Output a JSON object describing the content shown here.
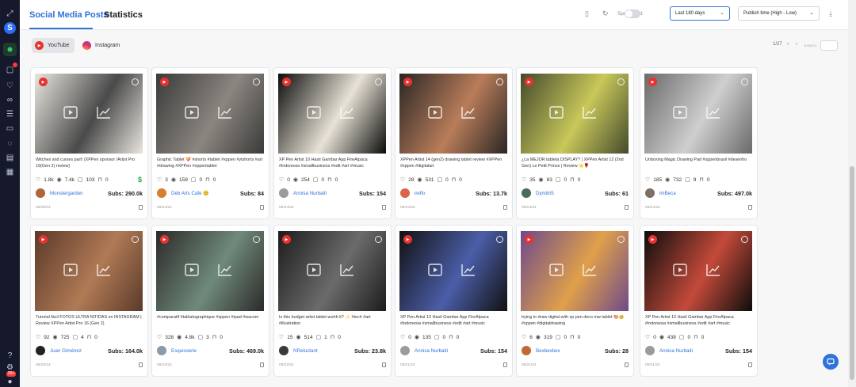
{
  "sidebar": {
    "logo": "S",
    "notification_badge": "99+",
    "icons": [
      "expand-icon",
      "logo-icon",
      "collaborators-icon",
      "notes-icon",
      "heart-icon",
      "link-icon",
      "list-icon",
      "folder-icon",
      "lightbulb-icon",
      "archive-icon",
      "calendar-icon",
      "help-icon",
      "settings-icon",
      "user-icon"
    ]
  },
  "header": {
    "tab_posts": "Social Media Posts",
    "tab_stats": "Statistics",
    "sponsored_label": "Sponsored",
    "sponsored_on": false,
    "date_range": "Last 180 days",
    "sort": "Publish time (High - Low)"
  },
  "platforms": [
    {
      "label": "YouTube",
      "active": true
    },
    {
      "label": "Instagram",
      "active": false
    }
  ],
  "pagination": {
    "page": "1/27",
    "goto_label": "Jump to"
  },
  "colors": {
    "accent": "#2f73da",
    "youtube": "#e8322e",
    "sponsor": "#22a653"
  },
  "cards": [
    {
      "caption": "Witches and curses part! (XPPen sponsor /Artist Pro 19(Gen 2) review)",
      "likes": "1.8k",
      "views": "7.4k",
      "comments": "103",
      "dislikes": "0",
      "sponsored": true,
      "author": "Monstergarden",
      "subs": "Subs: 290.0k",
      "date": "09/05/24",
      "thumb": [
        "#e9e6df",
        "#4a4a4a"
      ],
      "avatar": "#b0663c"
    },
    {
      "caption": "Graphic Tablet 💝 #shorts #tablet #xppen #ytshorts #art #drawing #XPPen #xppentablet",
      "likes": "3",
      "views": "159",
      "comments": "0",
      "dislikes": "0",
      "sponsored": false,
      "author": "Deb Arts Cafe 😊",
      "subs": "Subs: 84",
      "date": "09/24/24",
      "thumb": [
        "#3b3a39",
        "#8a8680"
      ],
      "avatar": "#d6802d"
    },
    {
      "caption": "XP Pen Artist 10 Hasil Gambar App FireAlpaca #indonesia #smallbusiness #edit #art #music",
      "likes": "0",
      "views": "254",
      "comments": "0",
      "dislikes": "0",
      "sponsored": false,
      "author": "Annisa Nurbaiti",
      "subs": "Subs: 154",
      "date": "09/24/24",
      "thumb": [
        "#0c0c0c",
        "#e8e3d6"
      ],
      "avatar": "#9b9b9b"
    },
    {
      "caption": "XPPen Artist 14 (gen2) drawing tablet review #XPPen #xppen #digitalart",
      "likes": "28",
      "views": "531",
      "comments": "0",
      "dislikes": "0",
      "sponsored": false,
      "author": "ireflo",
      "subs": "Subs: 13.7k",
      "date": "09/24/24",
      "thumb": [
        "#2a2624",
        "#b97d5a"
      ],
      "avatar": "#d9664a"
    },
    {
      "caption": "¿La MEJOR tableta DISPLAY? | XPPen Artist 12 (2nd Gen) Le Petit Prince | Review 🌟🌹",
      "likes": "35",
      "views": "83",
      "comments": "0",
      "dislikes": "0",
      "sponsored": false,
      "author": "Dymitri5",
      "subs": "Subs: 61",
      "date": "09/24/24",
      "thumb": [
        "#444a2c",
        "#c8c85a"
      ],
      "avatar": "#4d6b5a"
    },
    {
      "caption": "Unboxing Magic Drawing Pad #xppenbrasil #desenho",
      "likes": "185",
      "views": "732",
      "comments": "9",
      "dislikes": "0",
      "sponsored": false,
      "author": "imBeca",
      "subs": "Subs: 497.0k",
      "date": "09/24/24",
      "thumb": [
        "#6a6a6a",
        "#cfcfcf"
      ],
      "avatar": "#7d6f64"
    },
    {
      "caption": "Tutorial fácil FOTOS ULTRA NITIDAS en INSTAGRAM | Review XPPen Artist Pro 16 (Gen 2)",
      "likes": "92",
      "views": "725",
      "comments": "4",
      "dislikes": "0",
      "sponsored": false,
      "author": "Juan Giménez",
      "subs": "Subs: 164.0k",
      "date": "09/20/24",
      "thumb": [
        "#5b3a2a",
        "#b07a55"
      ],
      "avatar": "#222222"
    },
    {
      "caption": "#comparatif #tablatographique #xppen #ipad #wacom",
      "likes": "328",
      "views": "4.8k",
      "comments": "3",
      "dislikes": "0",
      "sponsored": false,
      "author": "Esquisserie",
      "subs": "Subs: 469.0k",
      "date": "09/24/24",
      "thumb": [
        "#2c2a29",
        "#6f8a7a"
      ],
      "avatar": "#8a9aa8"
    },
    {
      "caption": "Is this budget artist tablet worth it? ✨ #tech #art #illustration",
      "likes": "15",
      "views": "514",
      "comments": "1",
      "dislikes": "0",
      "sponsored": false,
      "author": "NReluctant",
      "subs": "Subs: 23.8k",
      "date": "09/22/24",
      "thumb": [
        "#1c1c1c",
        "#6b6b6b"
      ],
      "avatar": "#3a3a3a"
    },
    {
      "caption": "XP Pen Artist 10 Hasil Gambar App FireAlpaca #indonesia #smallbusiness #edit #art #music",
      "likes": "0",
      "views": "135",
      "comments": "0",
      "dislikes": "0",
      "sponsored": false,
      "author": "Annisa Nurbaiti",
      "subs": "Subs: 154",
      "date": "09/21/24",
      "thumb": [
        "#111111",
        "#4b5ea8"
      ],
      "avatar": "#9b9b9b"
    },
    {
      "caption": "trying to draw digital with xp pen deco mw tablet 🎨🥳 #xppen #digitaldrawing",
      "likes": "6",
      "views": "319",
      "comments": "0",
      "dislikes": "0",
      "sponsored": false,
      "author": "Bexbexbex",
      "subs": "Subs: 28",
      "date": "09/21/24",
      "thumb": [
        "#6e4a8a",
        "#e0a04a"
      ],
      "avatar": "#c06a3a"
    },
    {
      "caption": "XP Pen Artist 10 Hasil Gambar App FireAlpaca #indonesia #smallbusiness #edit #art #music",
      "likes": "0",
      "views": "438",
      "comments": "0",
      "dislikes": "0",
      "sponsored": false,
      "author": "Annisa Nurbaiti",
      "subs": "Subs: 154",
      "date": "09/21/24",
      "thumb": [
        "#0d0d0d",
        "#c44a3a"
      ],
      "avatar": "#9b9b9b"
    }
  ]
}
